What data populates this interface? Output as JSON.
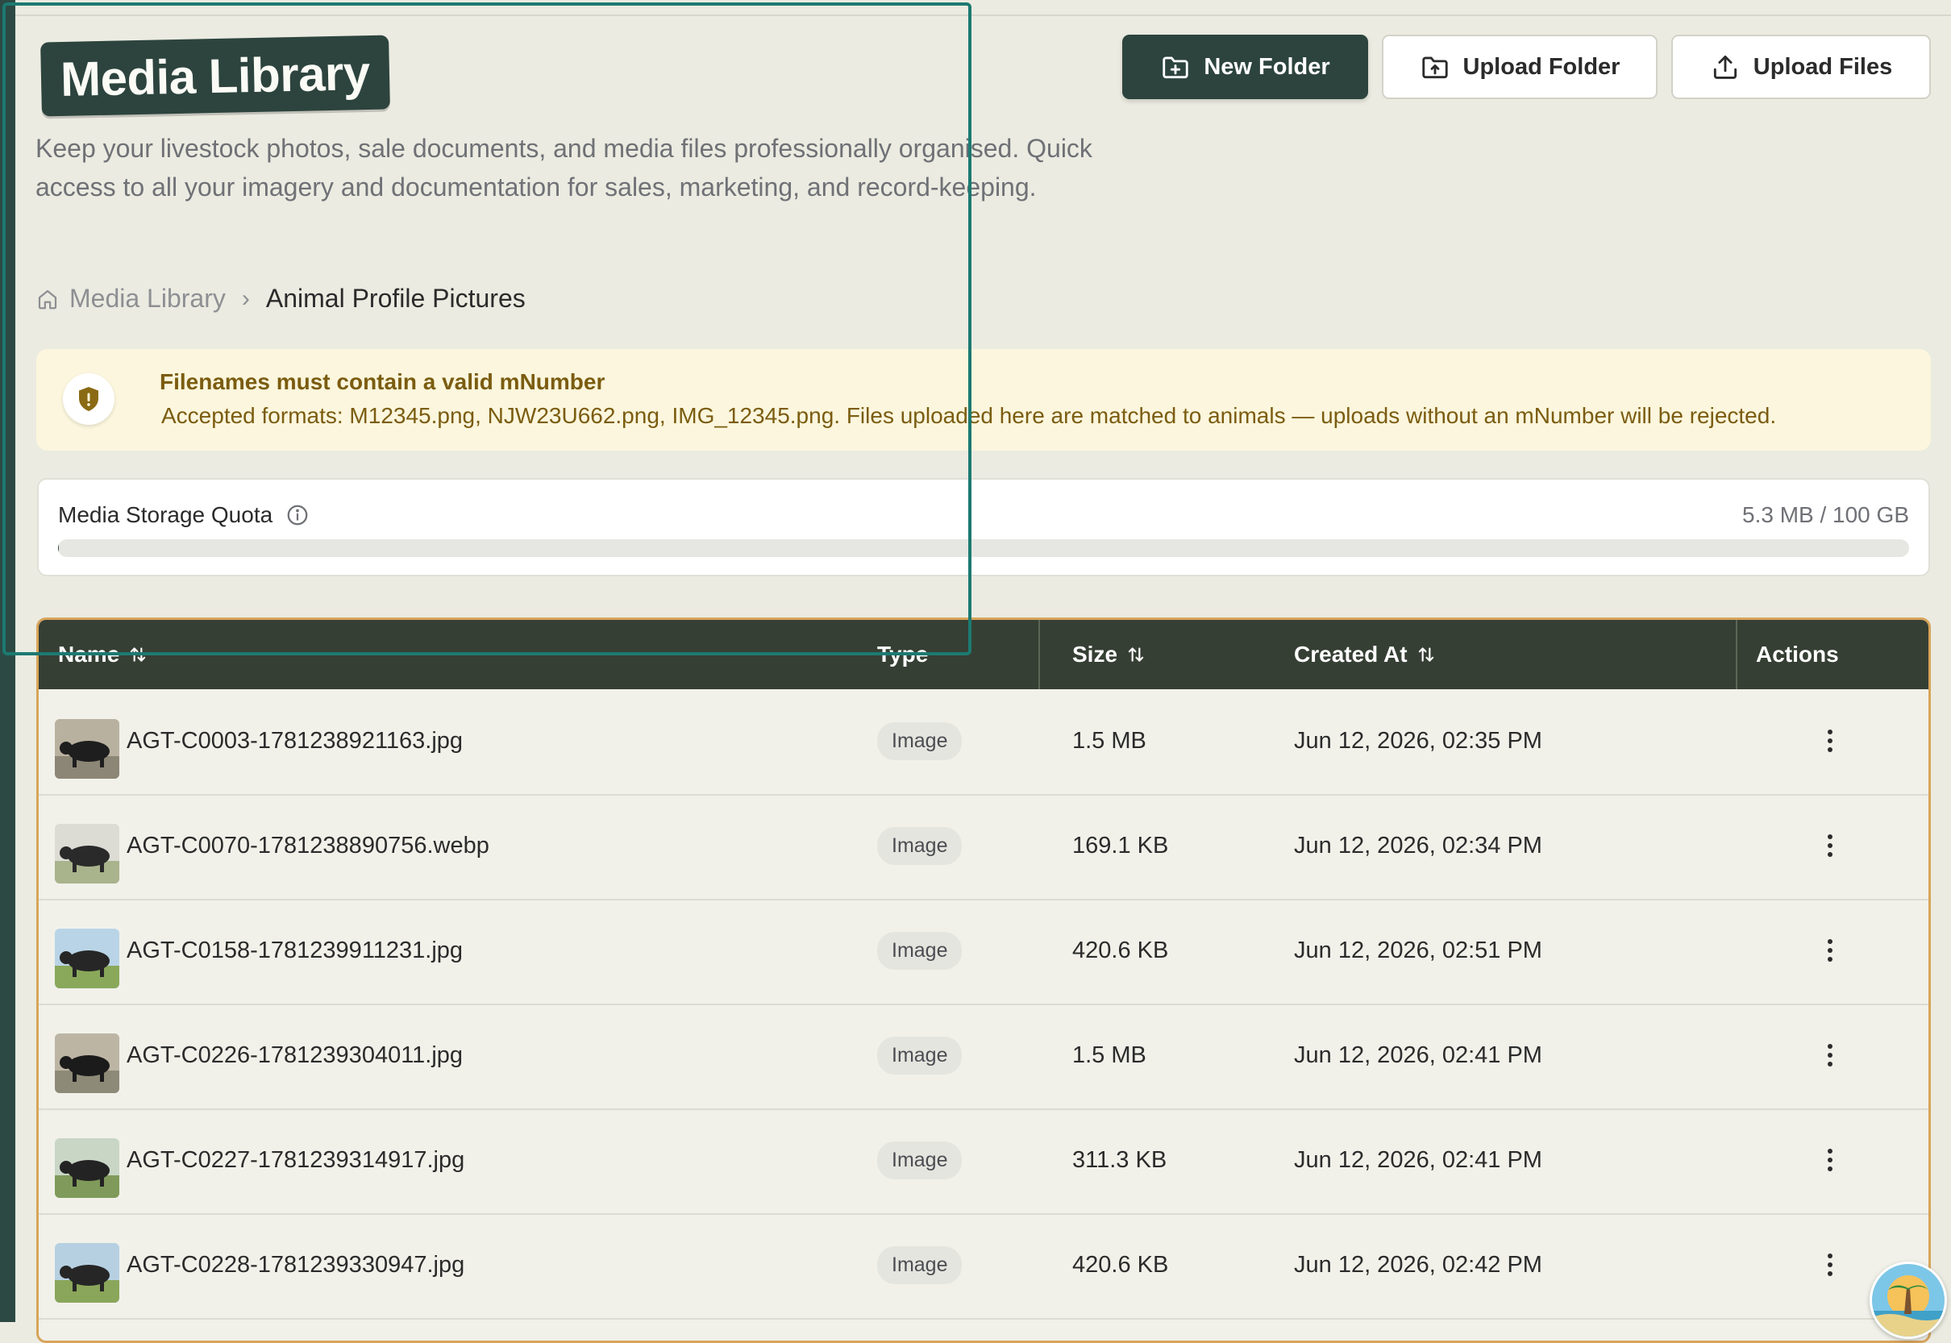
{
  "page": {
    "title": "Media Library",
    "subtitle": "Keep your livestock photos, sale documents, and media files professionally organised. Quick access to all your imagery and documentation for sales, marketing, and record-keeping."
  },
  "toolbar": {
    "new_folder": "New Folder",
    "upload_folder": "Upload Folder",
    "upload_files": "Upload Files"
  },
  "breadcrumb": {
    "root": "Media Library",
    "current": "Animal Profile Pictures"
  },
  "notice": {
    "title": "Filenames must contain a valid mNumber",
    "body": "Accepted formats: M12345.png, NJW23U662.png, IMG_12345.png. Files uploaded here are matched to animals — uploads without an mNumber will be rejected."
  },
  "quota": {
    "label": "Media Storage Quota",
    "value": "5.3 MB / 100 GB",
    "used_fraction": 5.3e-05
  },
  "table": {
    "headers": {
      "name": "Name",
      "type": "Type",
      "size": "Size",
      "created_at": "Created At",
      "actions": "Actions"
    },
    "rows": [
      {
        "name": "AGT-C0003-1781238921163.jpg",
        "type": "Image",
        "size": "1.5 MB",
        "created": "Jun 12, 2026, 02:35 PM"
      },
      {
        "name": "AGT-C0070-1781238890756.webp",
        "type": "Image",
        "size": "169.1 KB",
        "created": "Jun 12, 2026, 02:34 PM"
      },
      {
        "name": "AGT-C0158-1781239911231.jpg",
        "type": "Image",
        "size": "420.6 KB",
        "created": "Jun 12, 2026, 02:51 PM"
      },
      {
        "name": "AGT-C0226-1781239304011.jpg",
        "type": "Image",
        "size": "1.5 MB",
        "created": "Jun 12, 2026, 02:41 PM"
      },
      {
        "name": "AGT-C0227-1781239314917.jpg",
        "type": "Image",
        "size": "311.3 KB",
        "created": "Jun 12, 2026, 02:41 PM"
      },
      {
        "name": "AGT-C0228-1781239330947.jpg",
        "type": "Image",
        "size": "420.6 KB",
        "created": "Jun 12, 2026, 02:42 PM"
      }
    ]
  },
  "colors": {
    "accent_dark": "#2d443e",
    "table_header": "#363f34",
    "notice_bg": "#fbf6dd",
    "notice_text": "#7b5c10",
    "table_border": "#d8a45a",
    "focus_outline": "#1c7a72"
  },
  "icons": {
    "new_folder": "folder-plus-icon",
    "upload_folder": "folder-upload-icon",
    "upload_files": "upload-icon",
    "breadcrumb_home": "home-icon",
    "notice": "shield-alert-icon",
    "quota_info": "info-icon",
    "sort": "sort-arrows-icon",
    "row_actions": "more-vertical-icon"
  }
}
